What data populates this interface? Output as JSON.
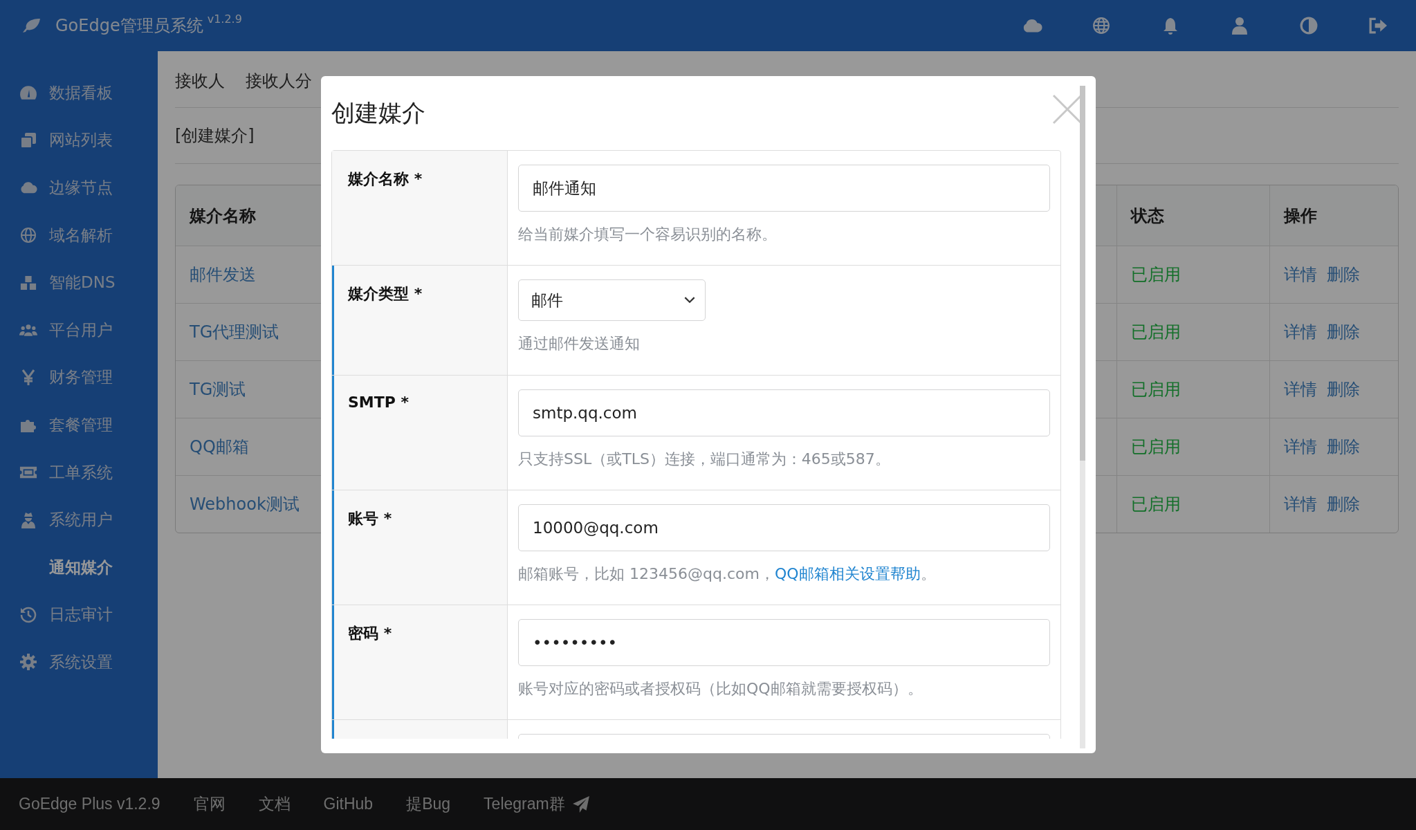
{
  "topbar": {
    "title": "GoEdge管理员系统",
    "version": "v1.2.9"
  },
  "sidebar": {
    "items": [
      {
        "label": "数据看板",
        "selected": false
      },
      {
        "label": "网站列表",
        "selected": false
      },
      {
        "label": "边缘节点",
        "selected": false
      },
      {
        "label": "域名解析",
        "selected": false
      },
      {
        "label": "智能DNS",
        "selected": false
      },
      {
        "label": "平台用户",
        "selected": false
      },
      {
        "label": "财务管理",
        "selected": false
      },
      {
        "label": "套餐管理",
        "selected": false
      },
      {
        "label": "工单系统",
        "selected": false
      },
      {
        "label": "系统用户",
        "selected": false
      },
      {
        "label": "通知媒介",
        "selected": true
      },
      {
        "label": "日志审计",
        "selected": false
      },
      {
        "label": "系统设置",
        "selected": false
      }
    ]
  },
  "tabs": [
    {
      "label": "接收人",
      "selected": false
    },
    {
      "label": "接收人分",
      "selected": false
    }
  ],
  "create_link": "[创建媒介]",
  "table": {
    "columns": [
      "媒介名称",
      "状态",
      "操作"
    ],
    "rows": [
      {
        "name": "邮件发送",
        "status": "已启用",
        "enabled": true,
        "actions": [
          "详情",
          "删除"
        ]
      },
      {
        "name": "TG代理测试",
        "status": "已启用",
        "enabled": true,
        "actions": [
          "详情",
          "删除"
        ]
      },
      {
        "name": "TG测试",
        "status": "已启用",
        "enabled": true,
        "actions": [
          "详情",
          "删除"
        ]
      },
      {
        "name": "QQ邮箱",
        "status": "已启用",
        "enabled": true,
        "actions": [
          "详情",
          "删除"
        ]
      },
      {
        "name": "Webhook测试",
        "status": "已启用",
        "enabled": true,
        "actions": [
          "详情",
          "删除"
        ]
      }
    ]
  },
  "modal": {
    "title": "创建媒介",
    "rows": [
      {
        "label": "媒介名称 *",
        "kind": "text",
        "value": "邮件通知",
        "help": "给当前媒介填写一个容易识别的名称。",
        "accent": false
      },
      {
        "label": "媒介类型 *",
        "kind": "select",
        "value": "邮件",
        "help": "通过邮件发送通知",
        "accent": true
      },
      {
        "label": "SMTP *",
        "kind": "text",
        "value": "smtp.qq.com",
        "help": "只支持SSL（或TLS）连接，端口通常为：465或587。",
        "accent": true
      },
      {
        "label": "账号 *",
        "kind": "text",
        "value": "10000@qq.com",
        "help": "邮箱账号，比如 123456@qq.com，",
        "help_link": "QQ邮箱相关设置帮助",
        "help_after": "。",
        "accent": true
      },
      {
        "label": "密码 *",
        "kind": "text",
        "value": "•••••••••",
        "help": "账号对应的密码或者授权码（比如QQ邮箱就需要授权码）。",
        "accent": true
      }
    ]
  },
  "footer": {
    "items": [
      "GoEdge Plus v1.2.9",
      "官网",
      "文档",
      "GitHub",
      "提Bug",
      "Telegram群"
    ]
  }
}
